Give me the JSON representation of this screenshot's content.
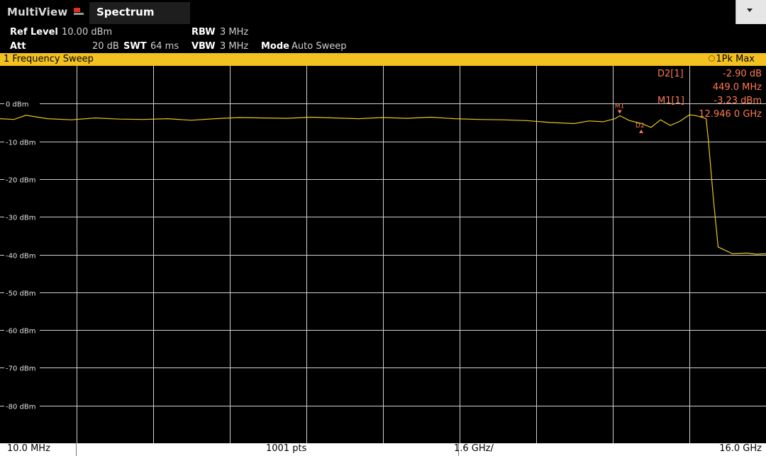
{
  "app": {
    "title": "MultiView",
    "tab": "Spectrum"
  },
  "info": {
    "ref_level_label": "Ref Level",
    "ref_level_value": "10.00 dBm",
    "att_label": "Att",
    "att_value": "20 dB",
    "swt_label": "SWT",
    "swt_value": "64 ms",
    "rbw_label": "RBW",
    "rbw_value": "3 MHz",
    "vbw_label": "VBW",
    "vbw_value": "3 MHz",
    "mode_label": "Mode",
    "mode_value": "Auto Sweep"
  },
  "panel": {
    "title": "1 Frequency Sweep",
    "trace": "1Pk Max"
  },
  "markers": {
    "d2_label": "D2[1]",
    "d2_level": "-2.90 dB",
    "d2_freq": "449.0 MHz",
    "m1_label": "M1[1]",
    "m1_level": "-3.23 dBm",
    "m1_freq": "12.946 0 GHz",
    "m1_name": "M1",
    "d2_name": "D2"
  },
  "footer": {
    "start": "10.0 MHz",
    "points": "1001 pts",
    "span_div": "1.6 GHz/",
    "stop": "16.0 GHz"
  },
  "colors": {
    "trace": "#e8c81e",
    "marker": "#ff7a50",
    "header": "#f3c220"
  },
  "chart_data": {
    "type": "line",
    "xlim": [
      0.01,
      16.0
    ],
    "ylim": [
      -90,
      10
    ],
    "y_ticks": [
      0,
      -10,
      -20,
      -30,
      -40,
      -50,
      -60,
      -70,
      -80
    ],
    "y_tick_labels": [
      "0 dBm",
      "-10 dBm",
      "-20 dBm",
      "-30 dBm",
      "-40 dBm",
      "-50 dBm",
      "-60 dBm",
      "-70 dBm",
      "-80 dBm"
    ],
    "x_divisions": 10,
    "grid": true,
    "series": [
      {
        "x": [
          0.01,
          0.3,
          0.55,
          1.0,
          1.5,
          2.0,
          2.5,
          3.0,
          3.5,
          4.0,
          4.5,
          5.0,
          5.5,
          6.0,
          6.5,
          7.0,
          7.5,
          8.0,
          8.5,
          9.0,
          9.5,
          10.0,
          10.5,
          11.0,
          11.5,
          12.0,
          12.3,
          12.6,
          12.85,
          12.95,
          13.15,
          13.4,
          13.6,
          13.8,
          14.0,
          14.2,
          14.4,
          14.5,
          14.6,
          14.75,
          14.8,
          14.9,
          15.0,
          15.3,
          15.6,
          15.8,
          16.0
        ],
        "y": [
          -4.0,
          -4.2,
          -3.1,
          -4.0,
          -4.3,
          -3.8,
          -4.1,
          -4.2,
          -4.0,
          -4.4,
          -4.0,
          -3.7,
          -3.8,
          -3.9,
          -3.6,
          -3.8,
          -4.0,
          -3.7,
          -3.9,
          -3.6,
          -4.0,
          -4.2,
          -4.3,
          -4.5,
          -5.0,
          -5.3,
          -4.6,
          -4.8,
          -4.0,
          -3.2,
          -4.5,
          -5.3,
          -6.3,
          -4.3,
          -5.8,
          -4.7,
          -3.0,
          -3.1,
          -3.4,
          -4.0,
          -10.0,
          -25.0,
          -38.0,
          -39.8,
          -39.6,
          -39.9,
          -39.8
        ]
      }
    ]
  }
}
